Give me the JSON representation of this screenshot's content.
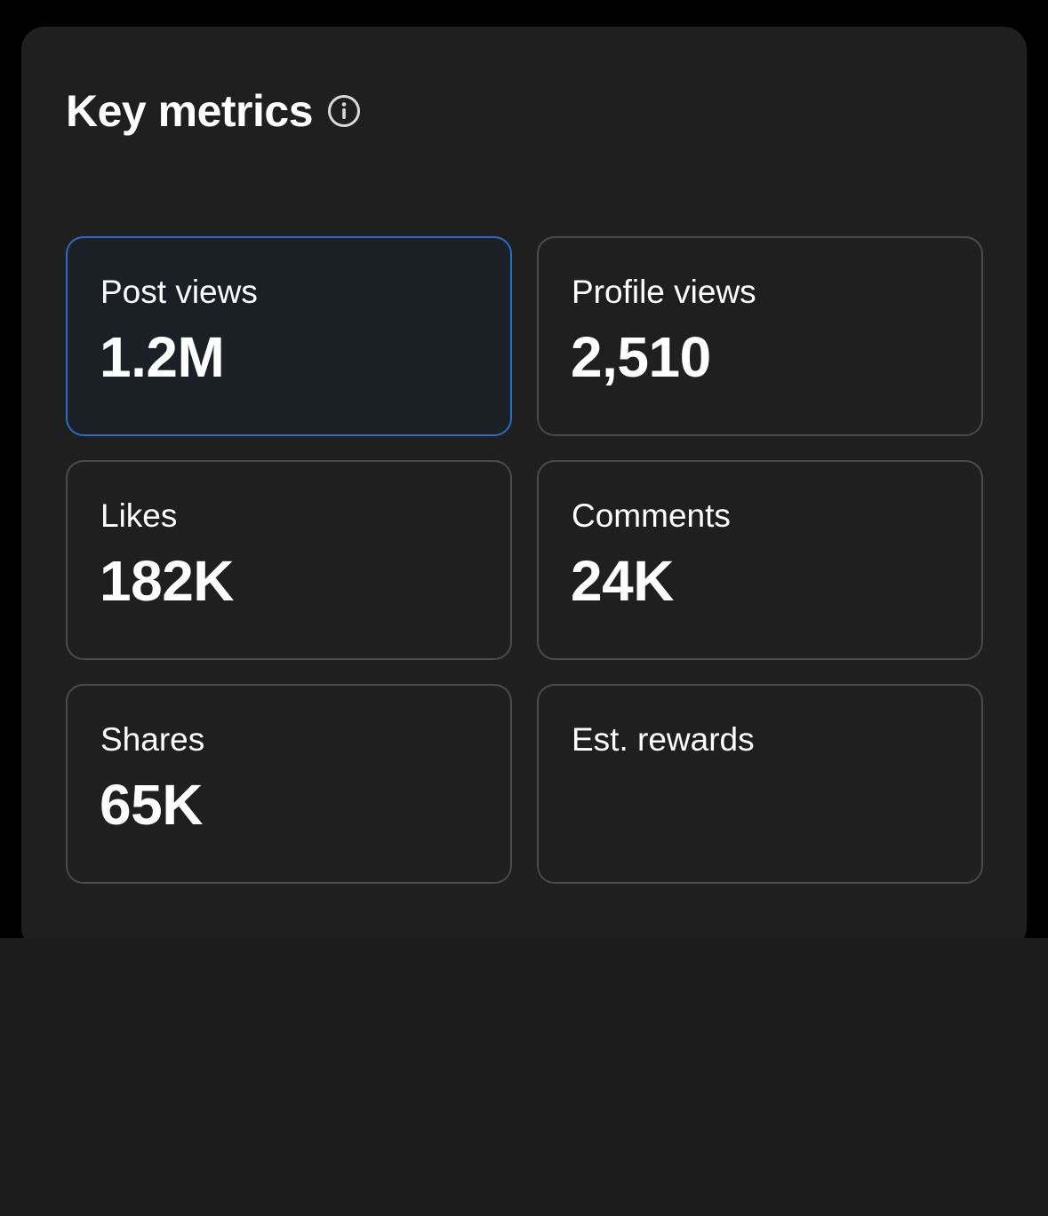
{
  "header": {
    "title": "Key metrics",
    "info_icon": "info-circle-icon"
  },
  "metrics": [
    {
      "label": "Post views",
      "value": "1.2M",
      "selected": true
    },
    {
      "label": "Profile views",
      "value": "2,510",
      "selected": false
    },
    {
      "label": "Likes",
      "value": "182K",
      "selected": false
    },
    {
      "label": "Comments",
      "value": "24K",
      "selected": false
    },
    {
      "label": "Shares",
      "value": "65K",
      "selected": false
    },
    {
      "label": "Est. rewards",
      "value": "",
      "selected": false
    }
  ],
  "colors": {
    "background": "#000000",
    "card": "#1f1f1f",
    "tile_border": "#4a4a4a",
    "selected_border": "#2a6cc0",
    "text": "#ffffff"
  }
}
